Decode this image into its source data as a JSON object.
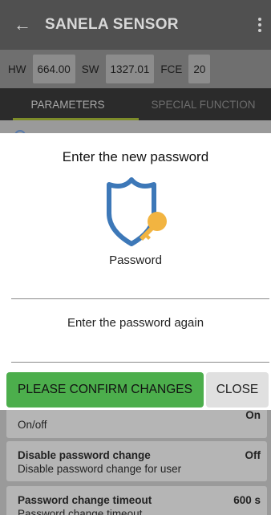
{
  "appbar": {
    "back_icon": "arrow-left-icon",
    "title": "SANELA SENSOR",
    "more_icon": "more-vert-icon"
  },
  "info": {
    "hw_label": "HW",
    "hw_value": "664.00",
    "sw_label": "SW",
    "sw_value": "1327.01",
    "fce_label": "FCE",
    "fce_value": "20"
  },
  "tabs": [
    {
      "label": "PARAMETERS",
      "active": true
    },
    {
      "label": "SPECIAL FUNCTION",
      "active": false
    }
  ],
  "rows": [
    {
      "title": "",
      "description": "On/off",
      "value": "On"
    },
    {
      "title": "Disable password change",
      "description": "Disable password change for user",
      "value": "Off"
    },
    {
      "title": "Password change timeout",
      "description": "Password change timeout",
      "value": "600 s"
    }
  ],
  "dialog": {
    "title": "Enter the new password",
    "password_label": "Password",
    "password_again_label": "Enter the password again",
    "confirm_label": "PLEASE CONFIRM CHANGES",
    "close_label": "CLOSE",
    "shield_color": "#3d78b8",
    "key_color": "#f2b441"
  },
  "colors": {
    "confirm_button": "#4cae4c",
    "tab_indicator": "#7d8c2a"
  }
}
